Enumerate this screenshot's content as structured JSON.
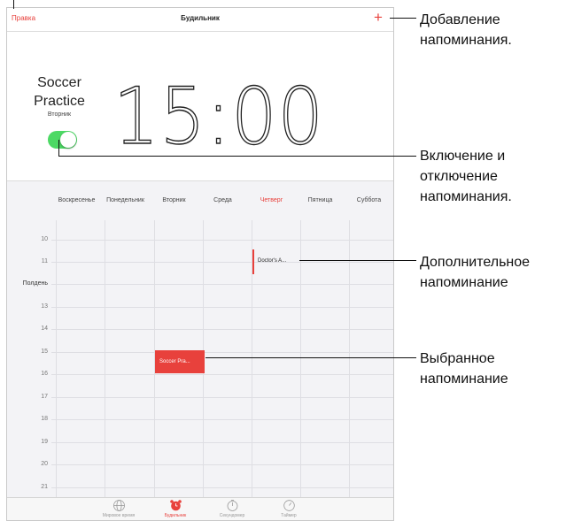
{
  "navbar": {
    "edit_label": "Правка",
    "title": "Будильник",
    "add_symbol": "+"
  },
  "alarm": {
    "name_line1": "Soccer",
    "name_line2": "Practice",
    "day": "Вторник",
    "time_hours": "15",
    "time_colon": ":",
    "time_minutes": "00",
    "enabled": true
  },
  "week": {
    "days": [
      "Воскресенье",
      "Понедельник",
      "Вторник",
      "Среда",
      "Четверг",
      "Пятница",
      "Суббота"
    ],
    "today_index": 4,
    "hours": [
      "10",
      "11",
      "Полдень",
      "13",
      "14",
      "15",
      "16",
      "17",
      "18",
      "19",
      "20",
      "21"
    ],
    "events": [
      {
        "title": "Doctor's A...",
        "day": "Четверг",
        "start_hour": "11"
      },
      {
        "title": "Soccer Pra...",
        "day": "Вторник",
        "start_hour": "15",
        "selected": true
      }
    ]
  },
  "tabs": [
    {
      "label": "Мировое время",
      "icon": "globe-icon"
    },
    {
      "label": "Будильник",
      "icon": "alarm-clock-icon",
      "active": true
    },
    {
      "label": "Секундомер",
      "icon": "stopwatch-icon"
    },
    {
      "label": "Таймер",
      "icon": "timer-icon"
    }
  ],
  "callouts": {
    "add": [
      "Добавление",
      "напоминания."
    ],
    "toggle": [
      "Включение и",
      "отключение",
      "напоминания."
    ],
    "additional": [
      "Дополнительное",
      "напоминание"
    ],
    "selected": [
      "Выбранное",
      "напоминание"
    ]
  },
  "colors": {
    "accent": "#e8413c",
    "toggle_on": "#4cd964",
    "callout": "#111111"
  }
}
